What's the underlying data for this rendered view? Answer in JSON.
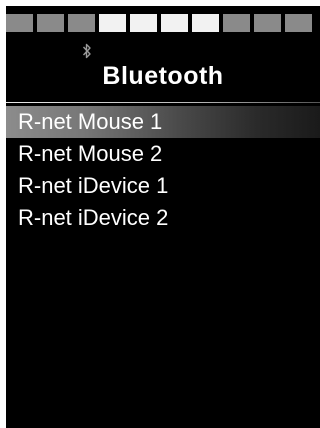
{
  "status_bar": {
    "segments": [
      {
        "state": "off"
      },
      {
        "state": "off"
      },
      {
        "state": "off"
      },
      {
        "state": "on"
      },
      {
        "state": "on"
      },
      {
        "state": "on"
      },
      {
        "state": "on"
      },
      {
        "state": "off"
      },
      {
        "state": "off"
      },
      {
        "state": "off"
      }
    ],
    "colors": {
      "on": "#f2f2f2",
      "off": "#8a8a8a"
    }
  },
  "header": {
    "icon": "bluetooth-icon",
    "title": "Bluetooth"
  },
  "menu": {
    "selected_index": 0,
    "items": [
      {
        "label": "R-net Mouse 1"
      },
      {
        "label": "R-net Mouse 2"
      },
      {
        "label": "R-net iDevice 1"
      },
      {
        "label": "R-net iDevice 2"
      }
    ]
  }
}
